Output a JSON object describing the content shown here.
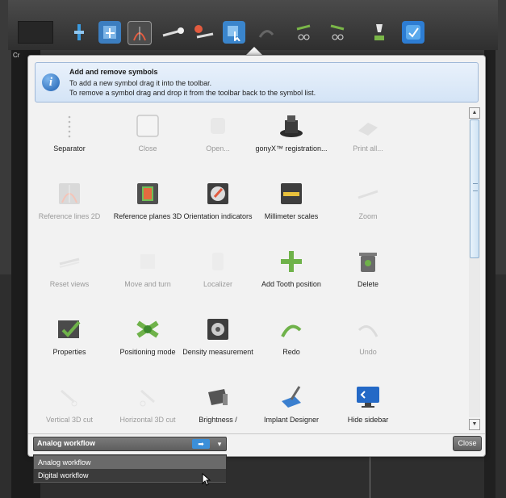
{
  "toolbar": {
    "icons": [
      "separator-icon",
      "move-icon",
      "select-icon",
      "reference-lines-icon",
      "distance-icon",
      "angle-measure-icon",
      "cursor-select-icon",
      "redo-icon",
      "cut-icon",
      "cut-icon",
      "implant-icon",
      "check-icon"
    ]
  },
  "window": {
    "partial_title": "Cr"
  },
  "info": {
    "title": "Add and remove symbols",
    "line1": "To add a new symbol drag it into the toolbar.",
    "line2": "To remove a symbol drag and drop it from the toolbar back to the symbol list."
  },
  "symbols": [
    {
      "label": "Separator",
      "icon": "separator-icon",
      "enabled": true
    },
    {
      "label": "Close",
      "icon": "close-icon",
      "enabled": false
    },
    {
      "label": "Open...",
      "icon": "open-icon",
      "enabled": false
    },
    {
      "label": "gonyX™ registration...",
      "icon": "gonyx-device-icon",
      "enabled": true
    },
    {
      "label": "Print all...",
      "icon": "print-icon",
      "enabled": false
    },
    {
      "label": "Reference lines 2D",
      "icon": "reference-lines-icon",
      "enabled": false
    },
    {
      "label": "Reference planes 3D",
      "icon": "reference-planes-icon",
      "enabled": true
    },
    {
      "label": "Orientation indicators",
      "icon": "orientation-icon",
      "enabled": true
    },
    {
      "label": "Millimeter scales",
      "icon": "ruler-icon",
      "enabled": true
    },
    {
      "label": "Zoom",
      "icon": "zoom-icon",
      "enabled": false
    },
    {
      "label": "Reset views",
      "icon": "reset-views-icon",
      "enabled": false
    },
    {
      "label": "Move and turn",
      "icon": "move-turn-icon",
      "enabled": false
    },
    {
      "label": "Localizer",
      "icon": "localizer-icon",
      "enabled": false
    },
    {
      "label": "Add Tooth position",
      "icon": "add-tooth-icon",
      "enabled": true
    },
    {
      "label": "Delete",
      "icon": "trash-icon",
      "enabled": true
    },
    {
      "label": "Properties",
      "icon": "properties-icon",
      "enabled": true
    },
    {
      "label": "Positioning mode",
      "icon": "positioning-icon",
      "enabled": true
    },
    {
      "label": "Density measurement",
      "icon": "density-icon",
      "enabled": true
    },
    {
      "label": "Redo",
      "icon": "redo-icon",
      "enabled": true
    },
    {
      "label": "Undo",
      "icon": "undo-icon",
      "enabled": false
    },
    {
      "label": "Vertical 3D cut",
      "icon": "vertical-cut-icon",
      "enabled": false
    },
    {
      "label": "Horizontal 3D cut",
      "icon": "horizontal-cut-icon",
      "enabled": false
    },
    {
      "label": "Brightness /",
      "icon": "brightness-icon",
      "enabled": true
    },
    {
      "label": "Implant Designer",
      "icon": "implant-designer-icon",
      "enabled": true
    },
    {
      "label": "Hide sidebar",
      "icon": "monitor-icon",
      "enabled": true
    }
  ],
  "footer": {
    "workflow_selected": "Analog workflow",
    "close_label": "Close",
    "workflow_options": [
      "Analog workflow",
      "Digital workflow"
    ]
  },
  "colors": {
    "accent": "#3b8fd9",
    "info_bg": "#dbe8f7"
  }
}
